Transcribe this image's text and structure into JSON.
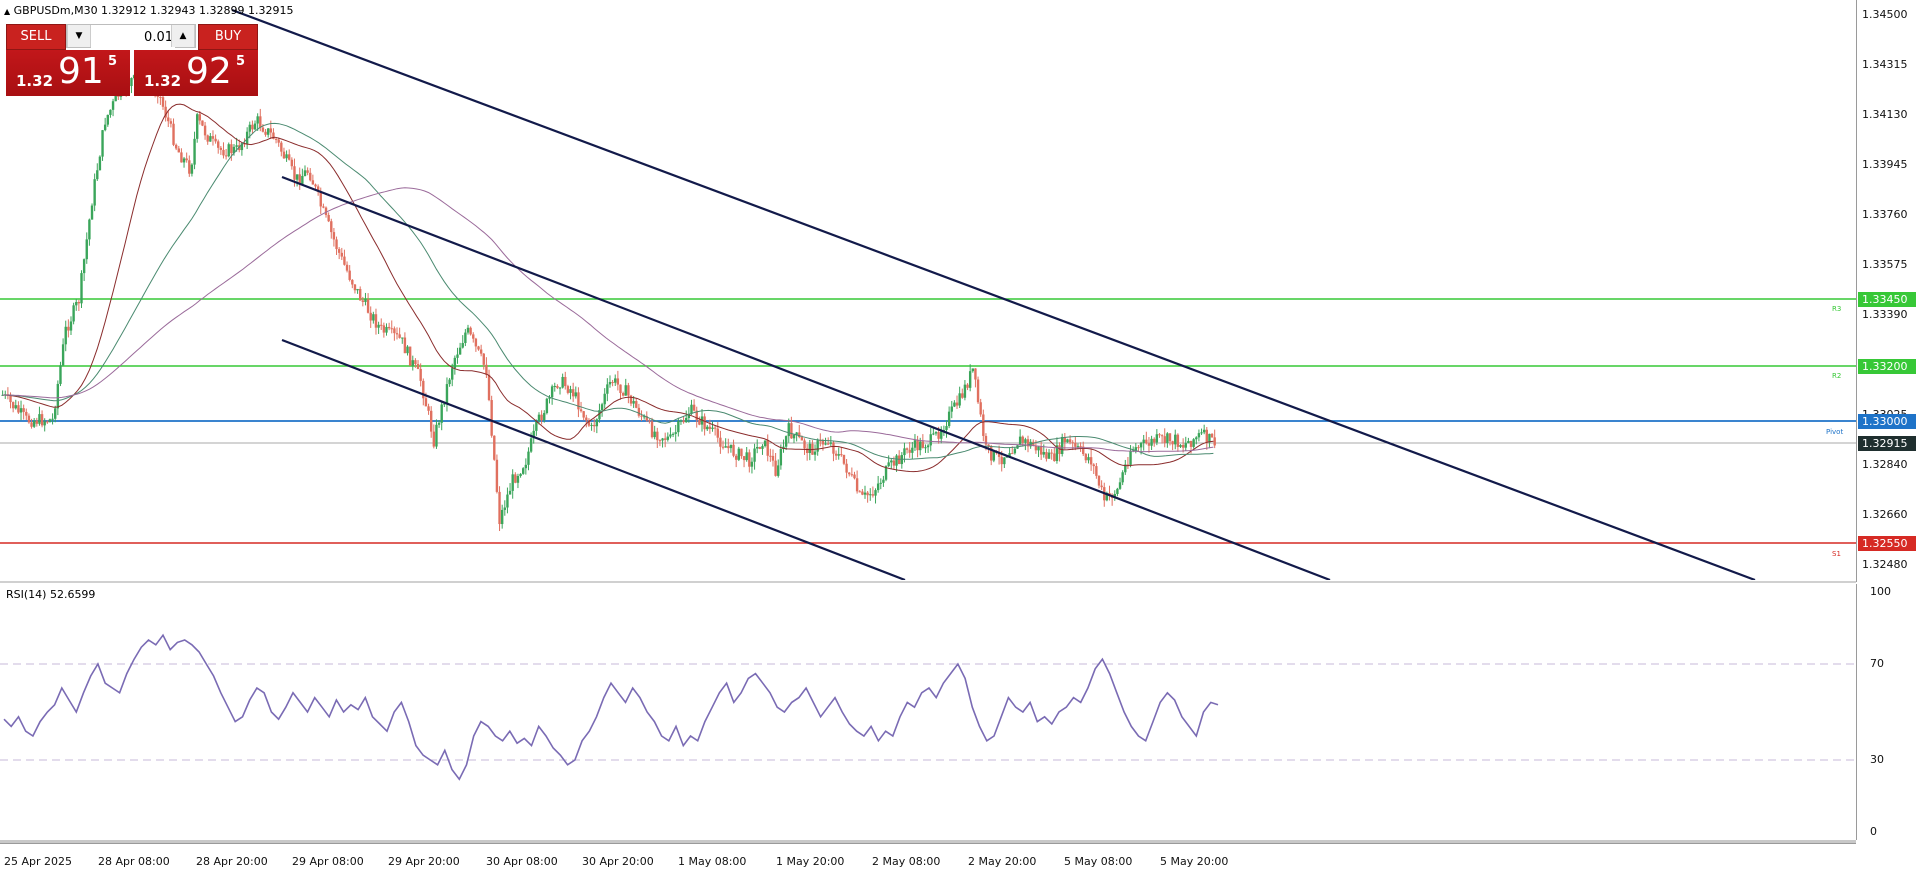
{
  "header": {
    "symbol_info": "GBPUSDm,M30  1.32912 1.32943 1.32899 1.32915"
  },
  "trade_panel": {
    "sell_label": "SELL",
    "buy_label": "BUY",
    "lot_value": "0.01",
    "sell_price_small": "1.32",
    "sell_price_big": "91",
    "sell_price_sup": "5",
    "buy_price_small": "1.32",
    "buy_price_big": "92",
    "buy_price_sup": "5"
  },
  "price_axis": {
    "ticks": [
      "1.34500",
      "1.34315",
      "1.34130",
      "1.33945",
      "1.33760",
      "1.33575",
      "1.33390",
      "1.33205",
      "1.33025",
      "1.32840",
      "1.32660",
      "1.32480"
    ],
    "labels": {
      "r3": {
        "value": "1.33450",
        "color": "#37c837",
        "marker": "R3"
      },
      "r2": {
        "value": "1.33200",
        "color": "#37c837",
        "marker": "R2"
      },
      "pivot": {
        "value": "1.33000",
        "color": "#1e73c8",
        "marker": "Pivot"
      },
      "current": {
        "value": "1.32915",
        "color": "#1f2f2f"
      },
      "s1": {
        "value": "1.32550",
        "color": "#d62a24",
        "marker": "S1"
      }
    },
    "range": [
      1.3248,
      1.345
    ]
  },
  "time_axis": {
    "labels": [
      "25 Apr 2025",
      "28 Apr 08:00",
      "28 Apr 20:00",
      "29 Apr 08:00",
      "29 Apr 20:00",
      "30 Apr 08:00",
      "30 Apr 20:00",
      "1 May 08:00",
      "1 May 20:00",
      "2 May 08:00",
      "2 May 20:00",
      "5 May 08:00",
      "5 May 20:00"
    ]
  },
  "rsi": {
    "title": "RSI(14) 52.6599",
    "ticks": [
      "100",
      "70",
      "30",
      "0"
    ],
    "levels": [
      70,
      30
    ],
    "line_color": "#7a6bb4",
    "values": [
      47,
      44,
      48,
      42,
      40,
      46,
      50,
      53,
      60,
      55,
      50,
      58,
      65,
      70,
      62,
      60,
      58,
      66,
      72,
      77,
      80,
      78,
      82,
      76,
      79,
      80,
      78,
      75,
      70,
      65,
      58,
      52,
      46,
      48,
      55,
      60,
      58,
      50,
      47,
      52,
      58,
      54,
      50,
      56,
      52,
      48,
      55,
      50,
      53,
      51,
      56,
      48,
      45,
      42,
      50,
      54,
      46,
      36,
      32,
      30,
      28,
      34,
      26,
      22,
      28,
      40,
      46,
      44,
      40,
      38,
      42,
      37,
      39,
      36,
      44,
      40,
      35,
      32,
      28,
      30,
      38,
      42,
      48,
      56,
      62,
      58,
      54,
      60,
      56,
      50,
      46,
      40,
      38,
      44,
      36,
      40,
      38,
      46,
      52,
      58,
      62,
      54,
      58,
      64,
      66,
      62,
      58,
      52,
      50,
      54,
      56,
      60,
      54,
      48,
      52,
      56,
      50,
      45,
      42,
      40,
      44,
      38,
      42,
      40,
      48,
      54,
      52,
      58,
      60,
      56,
      62,
      66,
      70,
      64,
      52,
      44,
      38,
      40,
      48,
      56,
      52,
      50,
      54,
      46,
      48,
      45,
      50,
      52,
      56,
      54,
      60,
      68,
      72,
      66,
      58,
      50,
      44,
      40,
      38,
      46,
      54,
      58,
      55,
      48,
      44,
      40,
      50,
      54,
      53
    ]
  }
}
